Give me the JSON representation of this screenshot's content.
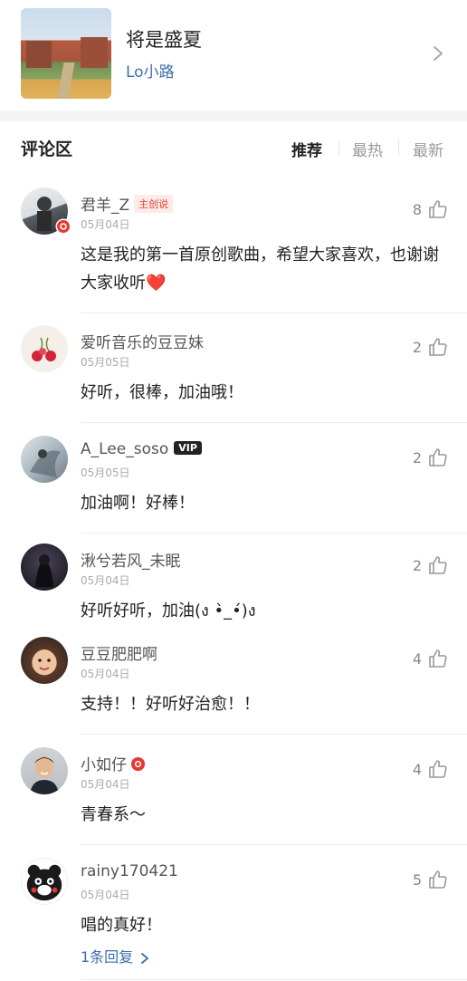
{
  "song": {
    "title": "将是盛夏",
    "artist": "Lo小路"
  },
  "comments_header": {
    "title": "评论区",
    "tabs": [
      "推荐",
      "最热",
      "最新"
    ],
    "active_tab": "推荐"
  },
  "colors": {
    "link": "#3b6fa8",
    "creator_badge": "#e0452f",
    "heart": "#e53935"
  },
  "comments": [
    {
      "username": "君羊_Z",
      "badge": "主创说",
      "date": "05月04日",
      "content": "这是我的第一首原创歌曲，希望大家喜欢，也谢谢大家收听",
      "emoji": "❤️",
      "likes": "8"
    },
    {
      "username": "爱听音乐的豆豆妹",
      "date": "05月05日",
      "content": "好听，很棒，加油哦！",
      "likes": "2"
    },
    {
      "username": "A_Lee_soso",
      "badge": "VIP",
      "date": "05月05日",
      "content": "加油啊！好棒！",
      "likes": "2"
    },
    {
      "username": "湫兮若风_未眠",
      "date": "05月04日",
      "content": "好听好听，加油(ง •̀_•́)ง",
      "likes": "2"
    },
    {
      "username": "豆豆肥肥啊",
      "date": "05月04日",
      "content": "支持！！好听好治愈！！",
      "likes": "4"
    },
    {
      "username": "小如仔",
      "date": "05月04日",
      "content": "青春系～",
      "likes": "4"
    },
    {
      "username": "rainy170421",
      "date": "05月04日",
      "content": "唱的真好！",
      "likes": "5",
      "replies": "1条回复"
    }
  ]
}
